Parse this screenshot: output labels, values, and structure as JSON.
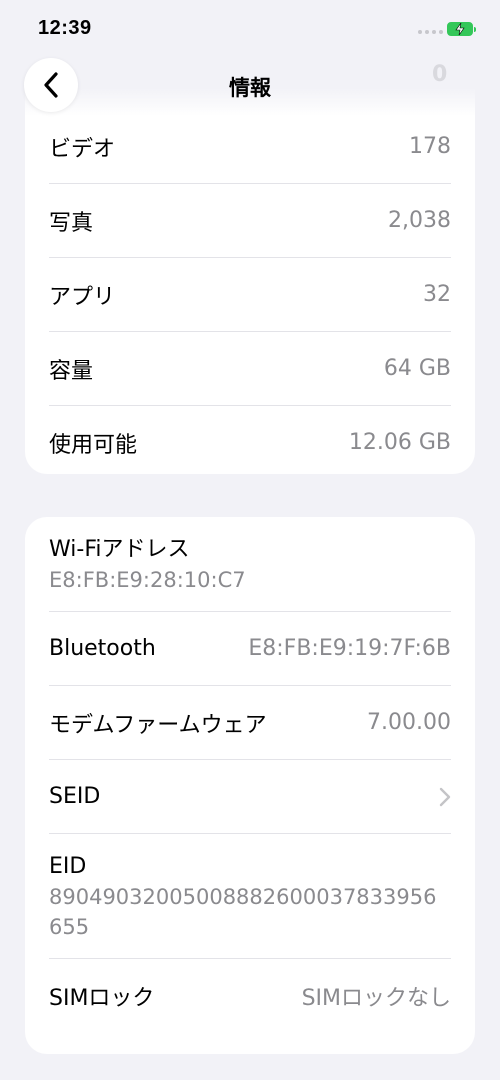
{
  "status_bar": {
    "time": "12:39",
    "battery_color": "#34c759"
  },
  "nav": {
    "title": "情報",
    "back_icon": "chevron-left-icon",
    "faded_char": "0"
  },
  "media_section": {
    "rows": [
      {
        "label": "ビデオ",
        "value": "178"
      },
      {
        "label": "写真",
        "value": "2,038"
      },
      {
        "label": "アプリ",
        "value": "32"
      },
      {
        "label": "容量",
        "value": "64 GB"
      },
      {
        "label": "使用可能",
        "value": "12.06 GB"
      }
    ]
  },
  "network_section": {
    "wifi": {
      "label": "Wi-Fiアドレス",
      "value": "E8:FB:E9:28:10:C7"
    },
    "bluetooth": {
      "label": "Bluetooth",
      "value": "E8:FB:E9:19:7F:6B"
    },
    "modem": {
      "label": "モデムファームウェア",
      "value": "7.00.00"
    },
    "seid": {
      "label": "SEID",
      "icon": "chevron-right-icon"
    },
    "eid": {
      "label": "EID",
      "value": "89049032005008882600037833956655"
    },
    "sim_lock": {
      "label": "SIMロック",
      "value": "SIMロックなし"
    }
  }
}
